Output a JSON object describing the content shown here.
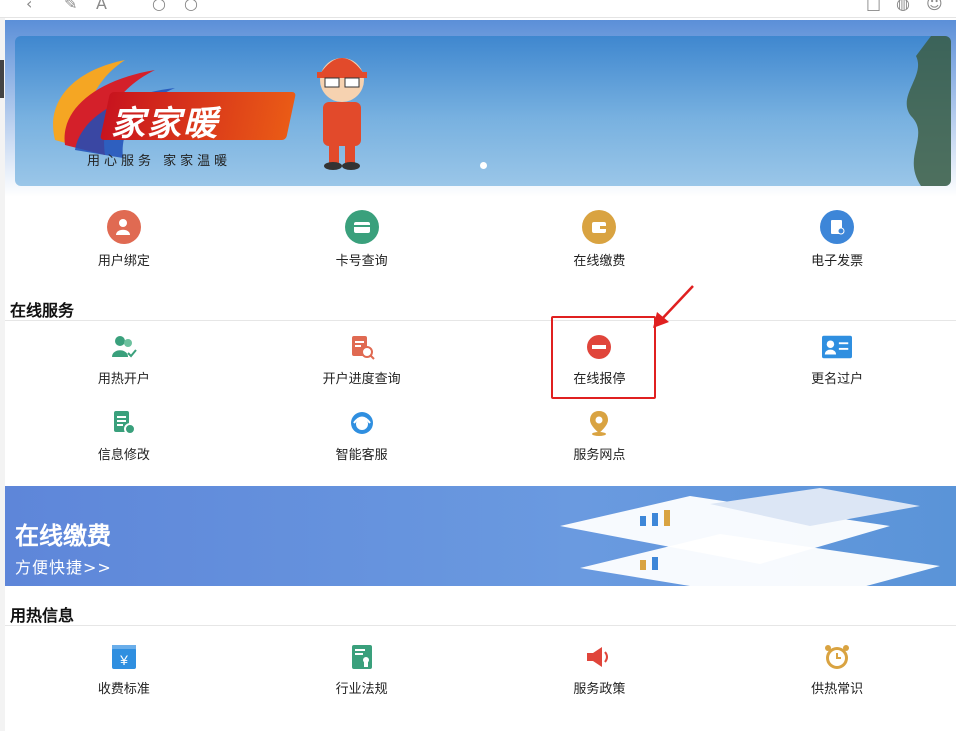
{
  "services_top": [
    {
      "label": "用户绑定",
      "icon": "user-bind-icon",
      "color": "#e06a52"
    },
    {
      "label": "卡号查询",
      "icon": "card-query-icon",
      "color": "#3aa07c"
    },
    {
      "label": "在线缴费",
      "icon": "wallet-icon",
      "color": "#d9a341"
    },
    {
      "label": "电子发票",
      "icon": "invoice-icon",
      "color": "#3d86d8"
    }
  ],
  "online_service": {
    "title": "在线服务",
    "row1": [
      {
        "label": "用热开户",
        "icon": "users-check-icon",
        "color": "#3aa07c"
      },
      {
        "label": "开户进度查询",
        "icon": "doc-search-icon",
        "color": "#e06a52"
      },
      {
        "label": "在线报停",
        "icon": "stop-icon",
        "color": "#e0453b"
      },
      {
        "label": "更名过户",
        "icon": "id-card-icon",
        "color": "#2f8fe0"
      }
    ],
    "row2": [
      {
        "label": "信息修改",
        "icon": "doc-settings-icon",
        "color": "#3aa07c"
      },
      {
        "label": "智能客服",
        "icon": "headset-icon",
        "color": "#2f8fe0"
      },
      {
        "label": "服务网点",
        "icon": "location-pin-icon",
        "color": "#d9a341"
      }
    ]
  },
  "pay_banner": {
    "title": "在线缴费",
    "subtitle": "方便快捷>>"
  },
  "heat_info": {
    "title": "用热信息",
    "items": [
      {
        "label": "收费标准",
        "icon": "yuan-icon",
        "color": "#2f8fe0"
      },
      {
        "label": "行业法规",
        "icon": "certificate-icon",
        "color": "#3aa07c"
      },
      {
        "label": "服务政策",
        "icon": "speaker-icon",
        "color": "#e0453b"
      },
      {
        "label": "供热常识",
        "icon": "alarm-clock-icon",
        "color": "#d9a341"
      }
    ]
  },
  "banner": {
    "brand": "家家暖",
    "slogan": "用心服务 家家温暖"
  }
}
